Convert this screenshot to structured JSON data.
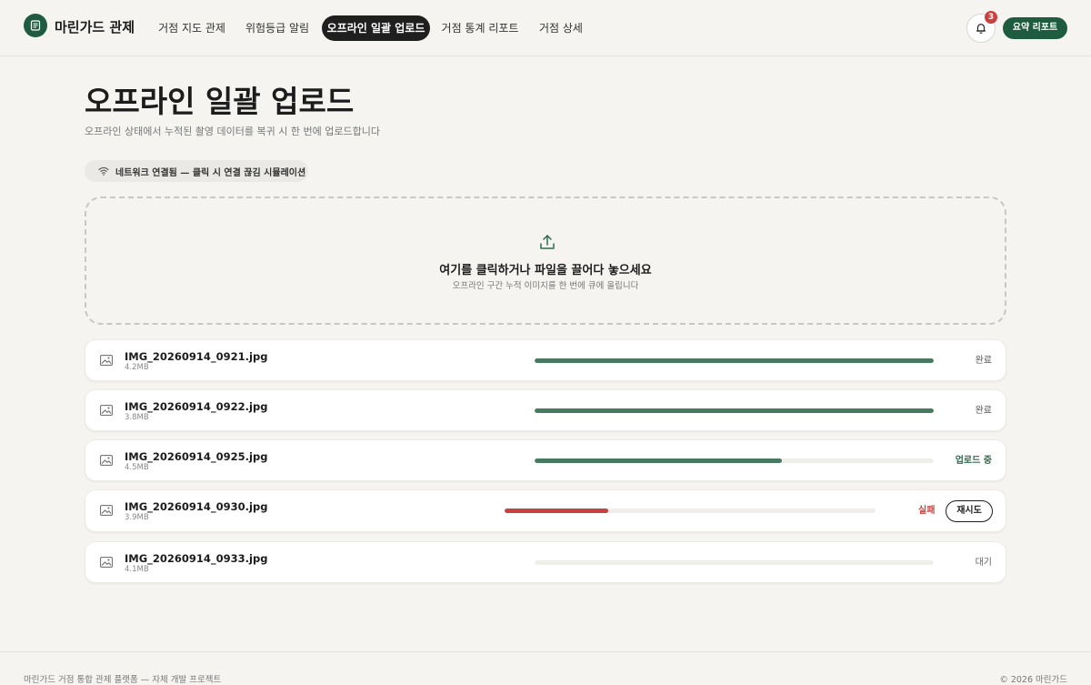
{
  "brand": {
    "name": "마린가드 관제",
    "logo_icon": "document-icon",
    "accent": "#1f5c3f"
  },
  "nav": [
    {
      "label": "거점 지도 관제",
      "active": false
    },
    {
      "label": "위험등급 알림",
      "active": false
    },
    {
      "label": "오프라인 일괄 업로드",
      "active": true
    },
    {
      "label": "거점 통계 리포트",
      "active": false
    },
    {
      "label": "거점 상세",
      "active": false
    }
  ],
  "notifications": {
    "count": "3",
    "icon": "bell-icon"
  },
  "report_button": "요약 리포트",
  "page": {
    "title": "오프라인 일괄 업로드",
    "subtitle": "오프라인 상태에서 누적된 촬영 데이터를 복귀 시 한 번에 업로드합니다"
  },
  "network": {
    "icon": "wifi-icon",
    "label": "네트워크 연결됨 — 클릭 시 연결 끊김 시뮬레이션"
  },
  "dropzone": {
    "icon": "upload-icon",
    "title": "여기를 클릭하거나 파일을 끌어다 놓으세요",
    "subtitle": "오프라인 구간 누적 이미지를 한 번에 큐에 올립니다"
  },
  "files": [
    {
      "name": "IMG_20260914_0921.jpg",
      "size": "4.2MB",
      "progress": 1.0,
      "status": "완료",
      "state": "done"
    },
    {
      "name": "IMG_20260914_0922.jpg",
      "size": "3.8MB",
      "progress": 1.0,
      "status": "완료",
      "state": "done"
    },
    {
      "name": "IMG_20260914_0925.jpg",
      "size": "4.5MB",
      "progress": 0.62,
      "status": "업로드 중",
      "state": "uploading"
    },
    {
      "name": "IMG_20260914_0930.jpg",
      "size": "3.9MB",
      "progress": 0.28,
      "status": "실패",
      "state": "failed",
      "retry": "재시도"
    },
    {
      "name": "IMG_20260914_0933.jpg",
      "size": "4.1MB",
      "progress": 0.0,
      "status": "대기",
      "state": "waiting"
    }
  ],
  "colors": {
    "progress_ok": "#487a62",
    "progress_fail": "#c94040",
    "status_uploading": "#2f6b4c",
    "status_fail": "#c94040"
  },
  "footer": {
    "left": "마린가드 거점 통합 관제 플랫폼 — 자체 개발 프로젝트",
    "right": "© 2026 마린가드"
  }
}
